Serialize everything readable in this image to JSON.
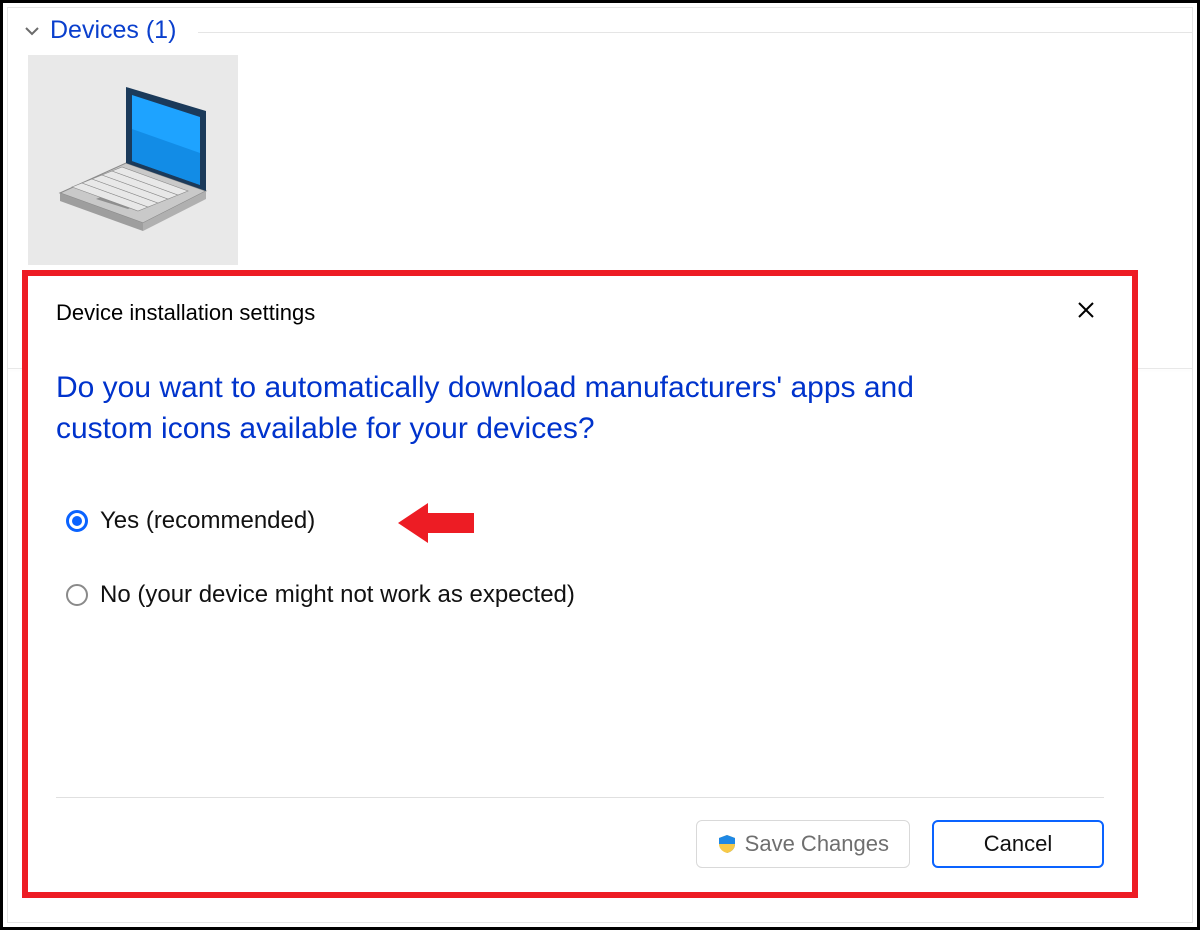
{
  "section": {
    "title": "Devices (1)"
  },
  "dialog": {
    "title": "Device installation settings",
    "question": "Do you want to automatically download manufacturers' apps and custom icons available for your devices?",
    "options": {
      "yes": "Yes (recommended)",
      "no": "No (your device might not work as expected)"
    },
    "selected": "yes",
    "buttons": {
      "save": "Save Changes",
      "cancel": "Cancel"
    }
  },
  "annotation": {
    "arrow_color": "#ed1c24",
    "highlight_border_color": "#ed1c24"
  }
}
